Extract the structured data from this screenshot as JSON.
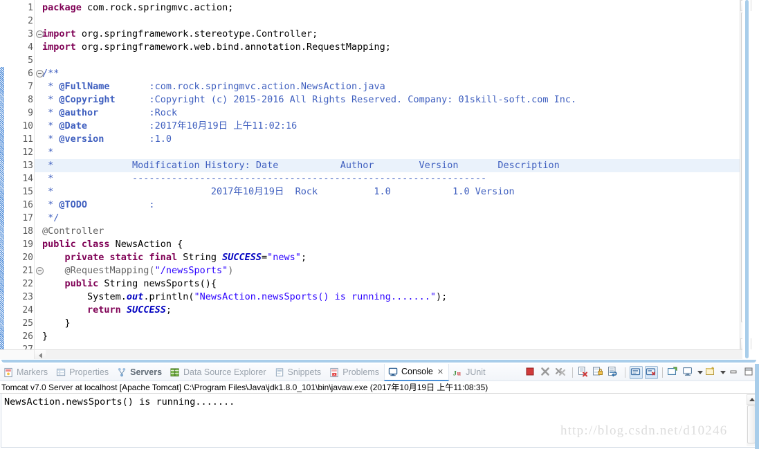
{
  "editor": {
    "first_line": 1,
    "lines": [
      {
        "n": 1,
        "fold": false,
        "hl": false,
        "tokens": [
          {
            "t": "package",
            "c": "kw"
          },
          {
            "t": " com.rock.springmvc.action;",
            "c": "plain"
          }
        ]
      },
      {
        "n": 2,
        "fold": false,
        "hl": false,
        "tokens": []
      },
      {
        "n": 3,
        "fold": true,
        "hl": false,
        "tokens": [
          {
            "t": "import",
            "c": "kw"
          },
          {
            "t": " org.springframework.stereotype.Controller;",
            "c": "plain"
          }
        ]
      },
      {
        "n": 4,
        "fold": false,
        "hl": false,
        "tokens": [
          {
            "t": "import",
            "c": "kw"
          },
          {
            "t": " org.springframework.web.bind.annotation.RequestMapping;",
            "c": "plain"
          }
        ]
      },
      {
        "n": 5,
        "fold": false,
        "hl": false,
        "tokens": []
      },
      {
        "n": 6,
        "fold": true,
        "hl": false,
        "tokens": [
          {
            "t": "/**",
            "c": "cmt"
          }
        ]
      },
      {
        "n": 7,
        "fold": false,
        "hl": false,
        "tokens": [
          {
            "t": " * ",
            "c": "cmt"
          },
          {
            "t": "@FullName",
            "c": "cmt-tag"
          },
          {
            "t": "       :com.rock.springmvc.action.NewsAction.java",
            "c": "cmt"
          }
        ]
      },
      {
        "n": 8,
        "fold": false,
        "hl": false,
        "tokens": [
          {
            "t": " * ",
            "c": "cmt"
          },
          {
            "t": "@Copyright",
            "c": "cmt-tag"
          },
          {
            "t": "      :Copyright (c) 2015-2016 All Rights Reserved. Company: 01skill-soft.com Inc.",
            "c": "cmt"
          }
        ]
      },
      {
        "n": 9,
        "fold": false,
        "hl": false,
        "tokens": [
          {
            "t": " * ",
            "c": "cmt"
          },
          {
            "t": "@author",
            "c": "cmt-tag"
          },
          {
            "t": "         :Rock",
            "c": "cmt"
          }
        ]
      },
      {
        "n": 10,
        "fold": false,
        "hl": false,
        "tokens": [
          {
            "t": " * ",
            "c": "cmt"
          },
          {
            "t": "@Date",
            "c": "cmt-tag"
          },
          {
            "t": "           :2017年10月19日 上午11:02:16",
            "c": "cmt"
          }
        ]
      },
      {
        "n": 11,
        "fold": false,
        "hl": false,
        "tokens": [
          {
            "t": " * ",
            "c": "cmt"
          },
          {
            "t": "@version",
            "c": "cmt-tag"
          },
          {
            "t": "        :1.0",
            "c": "cmt"
          }
        ]
      },
      {
        "n": 12,
        "fold": false,
        "hl": false,
        "tokens": [
          {
            "t": " *",
            "c": "cmt"
          }
        ]
      },
      {
        "n": 13,
        "fold": false,
        "hl": true,
        "tokens": [
          {
            "t": " *              Modification History: Date           Author        Version       Description",
            "c": "cmt"
          }
        ]
      },
      {
        "n": 14,
        "fold": false,
        "hl": false,
        "tokens": [
          {
            "t": " *              ---------------------------------------------------------------",
            "c": "cmt"
          }
        ]
      },
      {
        "n": 15,
        "fold": false,
        "hl": false,
        "tokens": [
          {
            "t": " *                            2017年10月19日  Rock          1.0           1.0 Version",
            "c": "cmt"
          }
        ]
      },
      {
        "n": 16,
        "fold": false,
        "hl": false,
        "tokens": [
          {
            "t": " * ",
            "c": "cmt"
          },
          {
            "t": "@TODO",
            "c": "cmt-tag"
          },
          {
            "t": "           :",
            "c": "cmt"
          }
        ]
      },
      {
        "n": 17,
        "fold": false,
        "hl": false,
        "tokens": [
          {
            "t": " */",
            "c": "cmt"
          }
        ]
      },
      {
        "n": 18,
        "fold": false,
        "hl": false,
        "tokens": [
          {
            "t": "@Controller",
            "c": "ann"
          }
        ]
      },
      {
        "n": 19,
        "fold": false,
        "hl": false,
        "tokens": [
          {
            "t": "public class",
            "c": "kw"
          },
          {
            "t": " NewsAction {",
            "c": "plain"
          }
        ]
      },
      {
        "n": 20,
        "fold": false,
        "hl": false,
        "tokens": [
          {
            "t": "    ",
            "c": "plain"
          },
          {
            "t": "private static final",
            "c": "kw"
          },
          {
            "t": " String ",
            "c": "plain"
          },
          {
            "t": "SUCCESS",
            "c": "sf"
          },
          {
            "t": "=",
            "c": "plain"
          },
          {
            "t": "\"news\"",
            "c": "str"
          },
          {
            "t": ";",
            "c": "plain"
          }
        ]
      },
      {
        "n": 21,
        "fold": true,
        "hl": false,
        "tokens": [
          {
            "t": "    ",
            "c": "plain"
          },
          {
            "t": "@RequestMapping(",
            "c": "ann"
          },
          {
            "t": "\"/newsSports\"",
            "c": "str"
          },
          {
            "t": ")",
            "c": "ann"
          }
        ]
      },
      {
        "n": 22,
        "fold": false,
        "hl": false,
        "tokens": [
          {
            "t": "    ",
            "c": "plain"
          },
          {
            "t": "public",
            "c": "kw"
          },
          {
            "t": " String newsSports(){",
            "c": "plain"
          }
        ]
      },
      {
        "n": 23,
        "fold": false,
        "hl": false,
        "tokens": [
          {
            "t": "        System.",
            "c": "plain"
          },
          {
            "t": "out",
            "c": "sf"
          },
          {
            "t": ".println(",
            "c": "plain"
          },
          {
            "t": "\"NewsAction.newsSports() is running.......\"",
            "c": "str"
          },
          {
            "t": ");",
            "c": "plain"
          }
        ]
      },
      {
        "n": 24,
        "fold": false,
        "hl": false,
        "tokens": [
          {
            "t": "        ",
            "c": "plain"
          },
          {
            "t": "return",
            "c": "kw"
          },
          {
            "t": " ",
            "c": "plain"
          },
          {
            "t": "SUCCESS",
            "c": "sf"
          },
          {
            "t": ";",
            "c": "plain"
          }
        ]
      },
      {
        "n": 25,
        "fold": false,
        "hl": false,
        "tokens": [
          {
            "t": "    }",
            "c": "plain"
          }
        ]
      },
      {
        "n": 26,
        "fold": false,
        "hl": false,
        "tokens": [
          {
            "t": "}",
            "c": "plain"
          }
        ]
      },
      {
        "n": 27,
        "fold": false,
        "hl": false,
        "tokens": []
      }
    ]
  },
  "bottom_view": {
    "tabs": [
      {
        "label": "Markers",
        "icon": "markers-icon",
        "state": "inactive"
      },
      {
        "label": "Properties",
        "icon": "properties-icon",
        "state": "inactive"
      },
      {
        "label": "Servers",
        "icon": "servers-icon",
        "state": "bold"
      },
      {
        "label": "Data Source Explorer",
        "icon": "data-source-explorer-icon",
        "state": "inactive"
      },
      {
        "label": "Snippets",
        "icon": "snippets-icon",
        "state": "inactive"
      },
      {
        "label": "Problems",
        "icon": "problems-icon",
        "state": "inactive"
      },
      {
        "label": "Console",
        "icon": "console-icon",
        "state": "active",
        "close": "✕"
      },
      {
        "label": "JUnit",
        "icon": "junit-icon",
        "state": "inactive"
      }
    ],
    "toolbar": [
      {
        "name": "terminate-button",
        "glyph": "stop"
      },
      {
        "name": "remove-launch-button",
        "glyph": "x-gray"
      },
      {
        "name": "remove-all-launches-button",
        "glyph": "xx-gray"
      },
      {
        "name": "clear-console-button",
        "glyph": "clear"
      },
      {
        "name": "scroll-lock-button",
        "glyph": "lock"
      },
      {
        "name": "word-wrap-button",
        "glyph": "wrap"
      },
      {
        "name": "show-console-on-output-button",
        "glyph": "console-out",
        "pressed": true
      },
      {
        "name": "show-console-on-error-button",
        "glyph": "console-err",
        "pressed": true
      },
      {
        "name": "pin-console-button",
        "glyph": "pin"
      },
      {
        "name": "display-selected-console-button",
        "glyph": "display"
      },
      {
        "name": "open-console-button",
        "glyph": "new-console"
      },
      {
        "name": "minimize-button",
        "glyph": "minimize"
      },
      {
        "name": "maximize-button",
        "glyph": "maximize"
      }
    ],
    "console": {
      "status": "Tomcat v7.0 Server at localhost [Apache Tomcat] C:\\Program Files\\Java\\jdk1.8.0_101\\bin\\javaw.exe (2017年10月19日 上午11:08:35)",
      "output": "NewsAction.newsSports() is running......."
    }
  },
  "watermark": {
    "text": "http://blog.csdn.net/d10246"
  },
  "colors": {
    "keyword": "#7f0055",
    "string": "#2a00ff",
    "comment": "#3f5fbf",
    "annotation": "#646464",
    "static_field": "#0000c0",
    "current_line": "#eaf2fb",
    "accent": "#4a90d9"
  }
}
